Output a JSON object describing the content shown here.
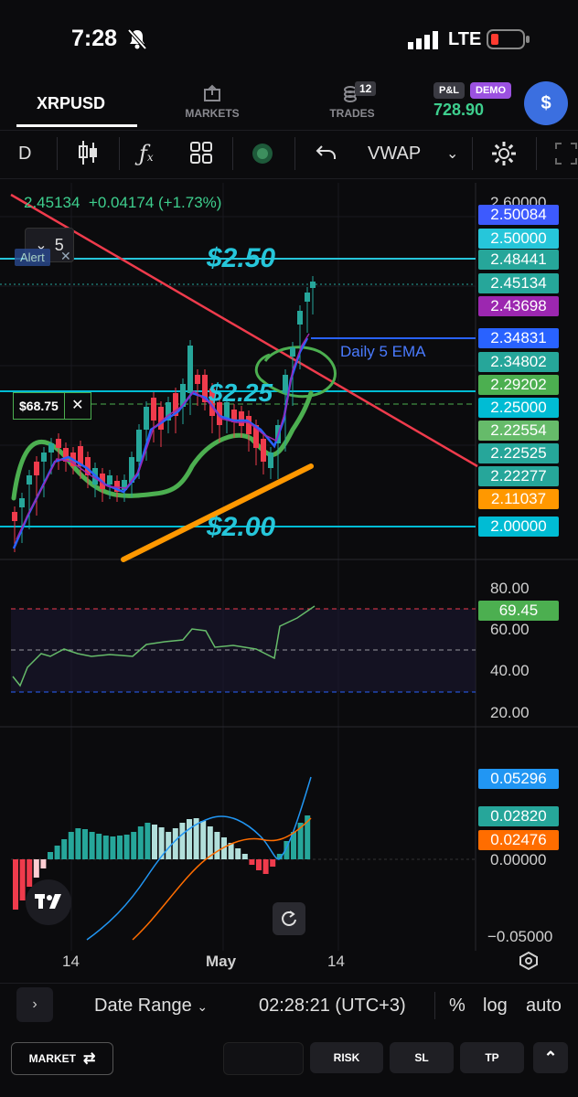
{
  "status": {
    "time": "7:28",
    "network": "LTE"
  },
  "header": {
    "symbol": "XRPUSD",
    "markets_label": "MARKETS",
    "trades_label": "TRADES",
    "trades_count": "12",
    "pnl_label": "P&L",
    "demo_label": "DEMO",
    "equity": "728.90",
    "dollar_label": "$"
  },
  "toolbar": {
    "interval": "D",
    "indicator": "VWAP"
  },
  "chart": {
    "ticker_line": "2.45134  +0.04174 (+1.73%)",
    "legend_collapse_count": "5",
    "alert_label": "Alert",
    "position_label": "$68.75",
    "close_glyph": "✕",
    "annotations": {
      "level_250": "$2.50",
      "level_225": "$2.25",
      "level_200": "$2.00",
      "ema_note": "Daily 5 EMA"
    },
    "price_axis_top": "2.60000",
    "price_labels": [
      {
        "value": "2.50084",
        "color": "#3d5afe"
      },
      {
        "value": "2.50000",
        "color": "#26c6da"
      },
      {
        "value": "2.48441",
        "color": "#26a69a"
      },
      {
        "value": "2.45134",
        "color": "#26a69a"
      },
      {
        "value": "2.43698",
        "color": "#9c27b0"
      },
      {
        "value": "2.34831",
        "color": "#2962ff"
      },
      {
        "value": "2.34802",
        "color": "#26a69a"
      },
      {
        "value": "2.29202",
        "color": "#4caf50"
      },
      {
        "value": "2.25000",
        "color": "#00bcd4"
      },
      {
        "value": "2.22554",
        "color": "#66bb6a"
      },
      {
        "value": "2.22525",
        "color": "#26a69a"
      },
      {
        "value": "2.22277",
        "color": "#26a69a"
      },
      {
        "value": "2.11037",
        "color": "#ff9800"
      },
      {
        "value": "2.00000",
        "color": "#00bcd4"
      }
    ]
  },
  "rsi": {
    "ticks": [
      "80.00",
      "60.00",
      "40.00",
      "20.00"
    ],
    "value": "69.45",
    "value_color": "#4caf50"
  },
  "macd": {
    "labels": [
      {
        "value": "0.05296",
        "color": "#2196f3"
      },
      {
        "value": "0.02820",
        "color": "#26a69a"
      },
      {
        "value": "0.02476",
        "color": "#ff6d00"
      }
    ],
    "zero": "0.00000",
    "bottom": "−0.05000"
  },
  "time_axis": {
    "labels": [
      "14",
      "May",
      "14"
    ]
  },
  "bottom_bar": {
    "date_range": "Date Range",
    "clock": "02:28:21 (UTC+3)",
    "percent": "%",
    "log": "log",
    "auto": "auto",
    "expand": "›"
  },
  "trade_bar": {
    "market": "MARKET",
    "risk": "RISK",
    "sl": "SL",
    "tp": "TP"
  }
}
